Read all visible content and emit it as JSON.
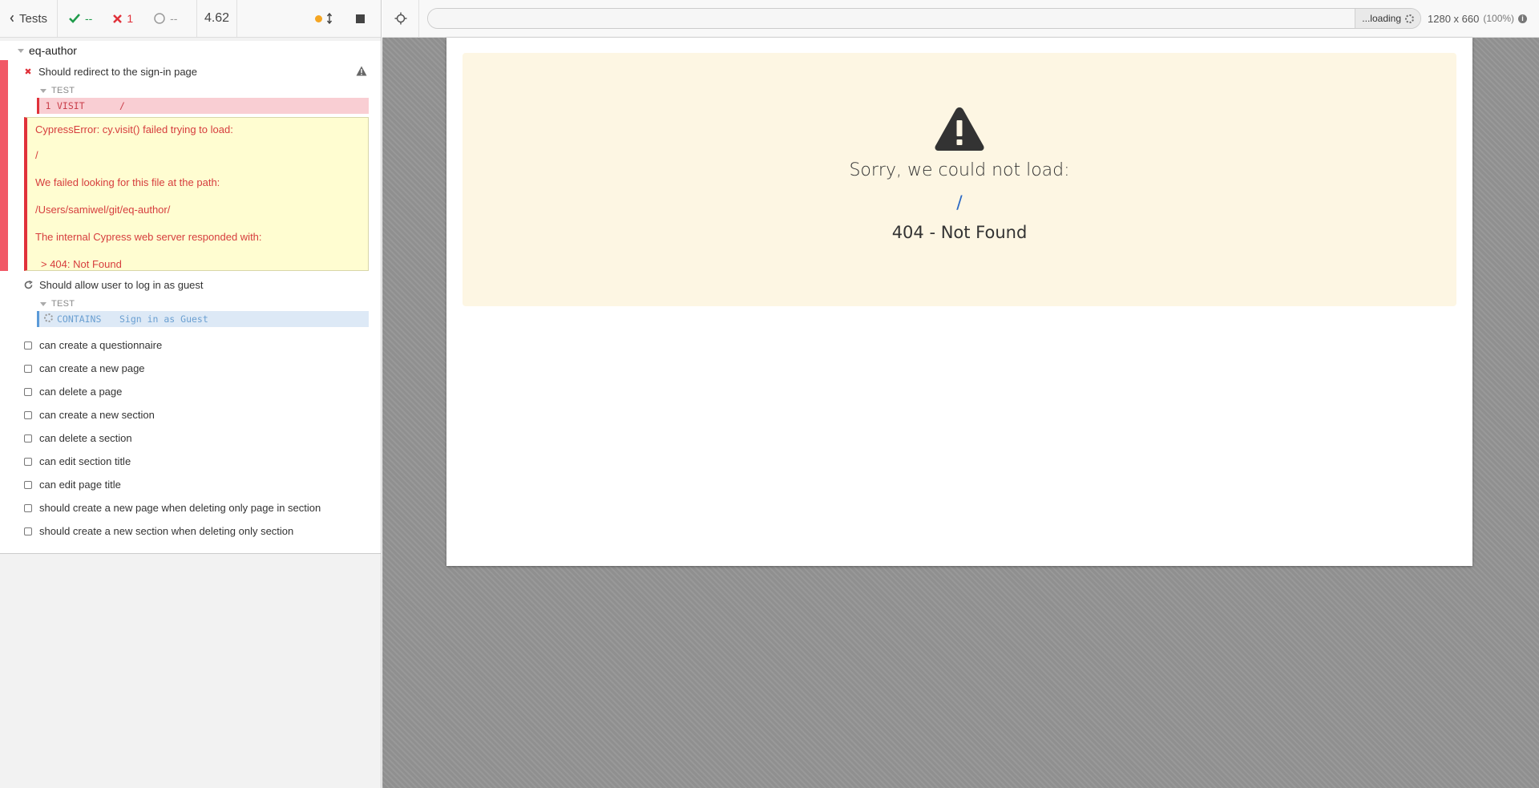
{
  "reporter": {
    "header": {
      "back_label": "Tests",
      "passed": "--",
      "failed": "1",
      "pending": "--",
      "duration": "4.62"
    },
    "suite": {
      "title": "eq-author",
      "tests": [
        {
          "title": "Should redirect to the sign-in page",
          "state": "failed",
          "section_label": "TEST",
          "command": {
            "number": "1",
            "name": "VISIT",
            "message": "/"
          },
          "error_lines": [
            "CypressError: cy.visit() failed trying to load:",
            "/",
            "We failed looking for this file at the path:",
            "/Users/samiwel/git/eq-author/",
            "The internal Cypress web server responded with:",
            "> 404: Not Found"
          ]
        },
        {
          "title": "Should allow user to log in as guest",
          "state": "running",
          "section_label": "TEST",
          "command": {
            "name": "CONTAINS",
            "message": "Sign in as Guest"
          }
        }
      ],
      "pending_tests": [
        "can create a questionnaire",
        "can create a new page",
        "can delete a page",
        "can create a new section",
        "can delete a section",
        "can edit section title",
        "can edit page title",
        "should create a new page when deleting only page in section",
        "should create a new section when deleting only section"
      ]
    }
  },
  "aut": {
    "url_value": "",
    "loading_label": "...loading",
    "viewport": "1280 x 660",
    "zoom": "(100%)",
    "error_page": {
      "title": "Sorry, we could not load:",
      "path": "/",
      "status": "404 - Not Found"
    }
  },
  "colors": {
    "fail_red": "#e0313a",
    "pass_green": "#1f9b4b",
    "warn_banner_bg": "#fdf6e3",
    "error_box_bg": "#fffdd1",
    "link_blue": "#2a68c4"
  }
}
